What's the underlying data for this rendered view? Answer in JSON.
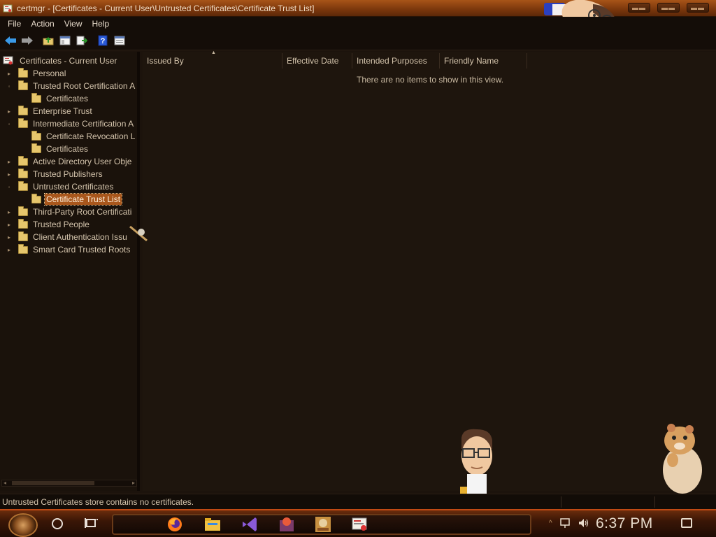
{
  "window": {
    "title": "certmgr - [Certificates - Current User\\Untrusted Certificates\\Certificate Trust List]"
  },
  "menu": [
    "File",
    "Action",
    "View",
    "Help"
  ],
  "toolbar": {
    "buttons": [
      "back-icon",
      "forward-icon",
      "up-folder-icon",
      "show-hide-tree-icon",
      "export-list-icon",
      "help-icon",
      "properties-icon"
    ]
  },
  "tree": {
    "root": "Certificates - Current User",
    "items": [
      {
        "label": "Personal",
        "level": 1,
        "expander": "collapsed"
      },
      {
        "label": "Trusted Root Certification A",
        "level": 1,
        "expander": "expanded"
      },
      {
        "label": "Certificates",
        "level": 2,
        "expander": "none"
      },
      {
        "label": "Enterprise Trust",
        "level": 1,
        "expander": "collapsed"
      },
      {
        "label": "Intermediate Certification A",
        "level": 1,
        "expander": "expanded"
      },
      {
        "label": "Certificate Revocation L",
        "level": 2,
        "expander": "none"
      },
      {
        "label": "Certificates",
        "level": 2,
        "expander": "none"
      },
      {
        "label": "Active Directory User Obje",
        "level": 1,
        "expander": "collapsed"
      },
      {
        "label": "Trusted Publishers",
        "level": 1,
        "expander": "collapsed"
      },
      {
        "label": "Untrusted Certificates",
        "level": 1,
        "expander": "expanded"
      },
      {
        "label": "Certificate Trust List",
        "level": 2,
        "expander": "none",
        "selected": true
      },
      {
        "label": "Third-Party Root Certificati",
        "level": 1,
        "expander": "collapsed"
      },
      {
        "label": "Trusted People",
        "level": 1,
        "expander": "collapsed"
      },
      {
        "label": "Client Authentication Issu",
        "level": 1,
        "expander": "collapsed"
      },
      {
        "label": "Smart Card Trusted Roots",
        "level": 1,
        "expander": "collapsed"
      }
    ]
  },
  "list": {
    "columns": [
      "Issued By",
      "Effective Date",
      "Intended Purposes",
      "Friendly Name"
    ],
    "empty_message": "There are no items to show in this view."
  },
  "status": {
    "text": "Untrusted Certificates store contains no certificates."
  },
  "taskbar": {
    "pinned": [
      "firefox-icon",
      "file-explorer-icon",
      "visual-studio-icon",
      "app-icon",
      "toolbox-icon",
      "certmgr-icon"
    ],
    "clock": "6:37 PM"
  },
  "colors": {
    "accent": "#a9571c",
    "background": "#1c130c",
    "titlebar": "#7a360c"
  }
}
